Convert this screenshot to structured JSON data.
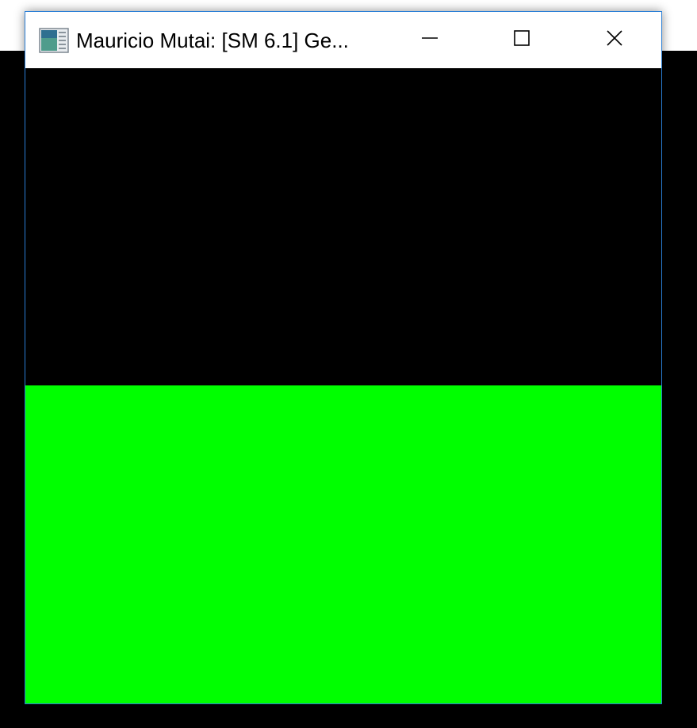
{
  "window": {
    "title": "Mauricio Mutai: [SM 6.1] Ge...",
    "icon": "application-icon",
    "controls": {
      "minimize_icon": "minimize-icon",
      "maximize_icon": "maximize-icon",
      "close_icon": "close-icon"
    }
  },
  "canvas": {
    "upper_color": "#000000",
    "lower_color": "#00ff00"
  },
  "colors": {
    "accent_border": "#2b7fd6",
    "titlebar_bg": "#ffffff",
    "desktop_bg": "#000000"
  }
}
